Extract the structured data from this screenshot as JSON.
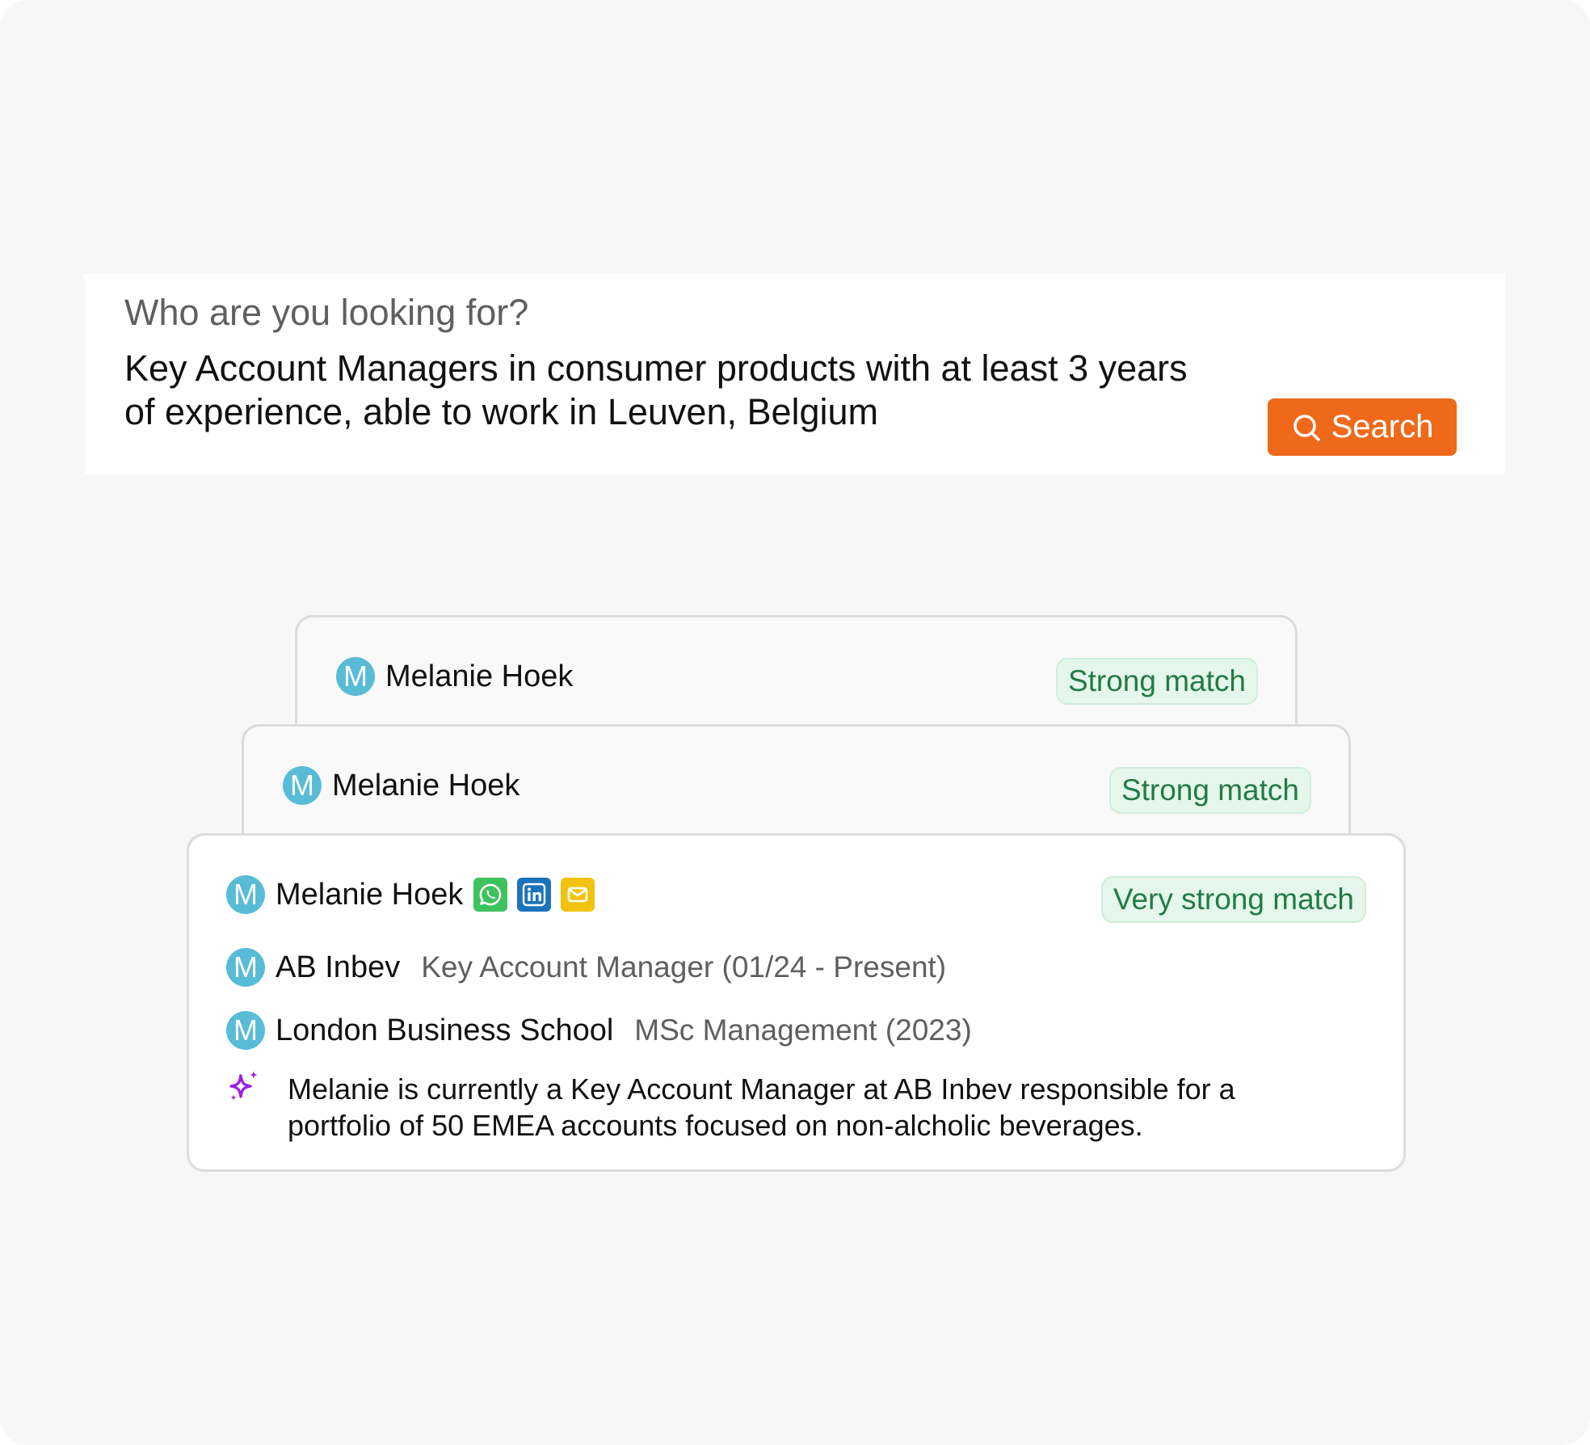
{
  "search": {
    "prompt": "Who are you looking for?",
    "query": "Key Account Managers in consumer products with at least 3 years of experience, able to work in Leuven, Belgium",
    "button_label": "Search",
    "button_color": "#ee6a1a"
  },
  "results": [
    {
      "avatar_letter": "M",
      "name": "Melanie Hoek",
      "match": "Strong match"
    },
    {
      "avatar_letter": "M",
      "name": "Melanie Hoek",
      "match": "Strong match"
    },
    {
      "avatar_letter": "M",
      "name": "Melanie Hoek",
      "match": "Very strong match",
      "contact_icons": [
        "whatsapp-icon",
        "linkedin-icon",
        "email-icon"
      ],
      "experience": {
        "avatar_letter": "M",
        "organization": "AB Inbev",
        "role": "Key Account Manager (01/24 - Present)"
      },
      "education": {
        "avatar_letter": "M",
        "organization": "London Business School",
        "degree": "MSc Management (2023)"
      },
      "summary_icon": "sparkle-icon",
      "summary": "Melanie is currently a Key Account Manager at AB Inbev responsible for a portfolio of 50 EMEA accounts focused on non-alcholic beverages."
    }
  ],
  "colors": {
    "avatar": "#58bcd6",
    "badge_text": "#237a46",
    "badge_bg": "#e4f7ea",
    "sparkle": "#9b1fe8"
  }
}
